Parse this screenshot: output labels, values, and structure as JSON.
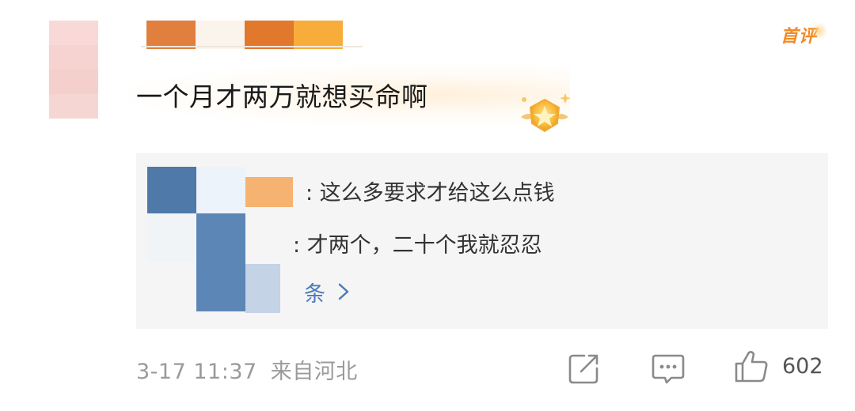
{
  "badge": {
    "first_comment": "首评"
  },
  "comment": {
    "text": "一个月才两万就想买命啊"
  },
  "replies": [
    {
      "text": ": 这么多要求才给这么点钱"
    },
    {
      "text": ": 才两个，二十个我就忍忍"
    }
  ],
  "more_replies": {
    "label": "条",
    "partial": "ll"
  },
  "footer": {
    "date": "3-17 11:37",
    "source": "来自河北",
    "like_count": "602"
  },
  "icons": [
    "share-icon",
    "comment-icon",
    "like-icon",
    "chevron-right-icon",
    "medal-icon"
  ],
  "colors": {
    "accent": "#f08a24",
    "link": "#4b7bb8",
    "meta": "#9a9a9a",
    "reply_bg": "#f5f5f5"
  }
}
